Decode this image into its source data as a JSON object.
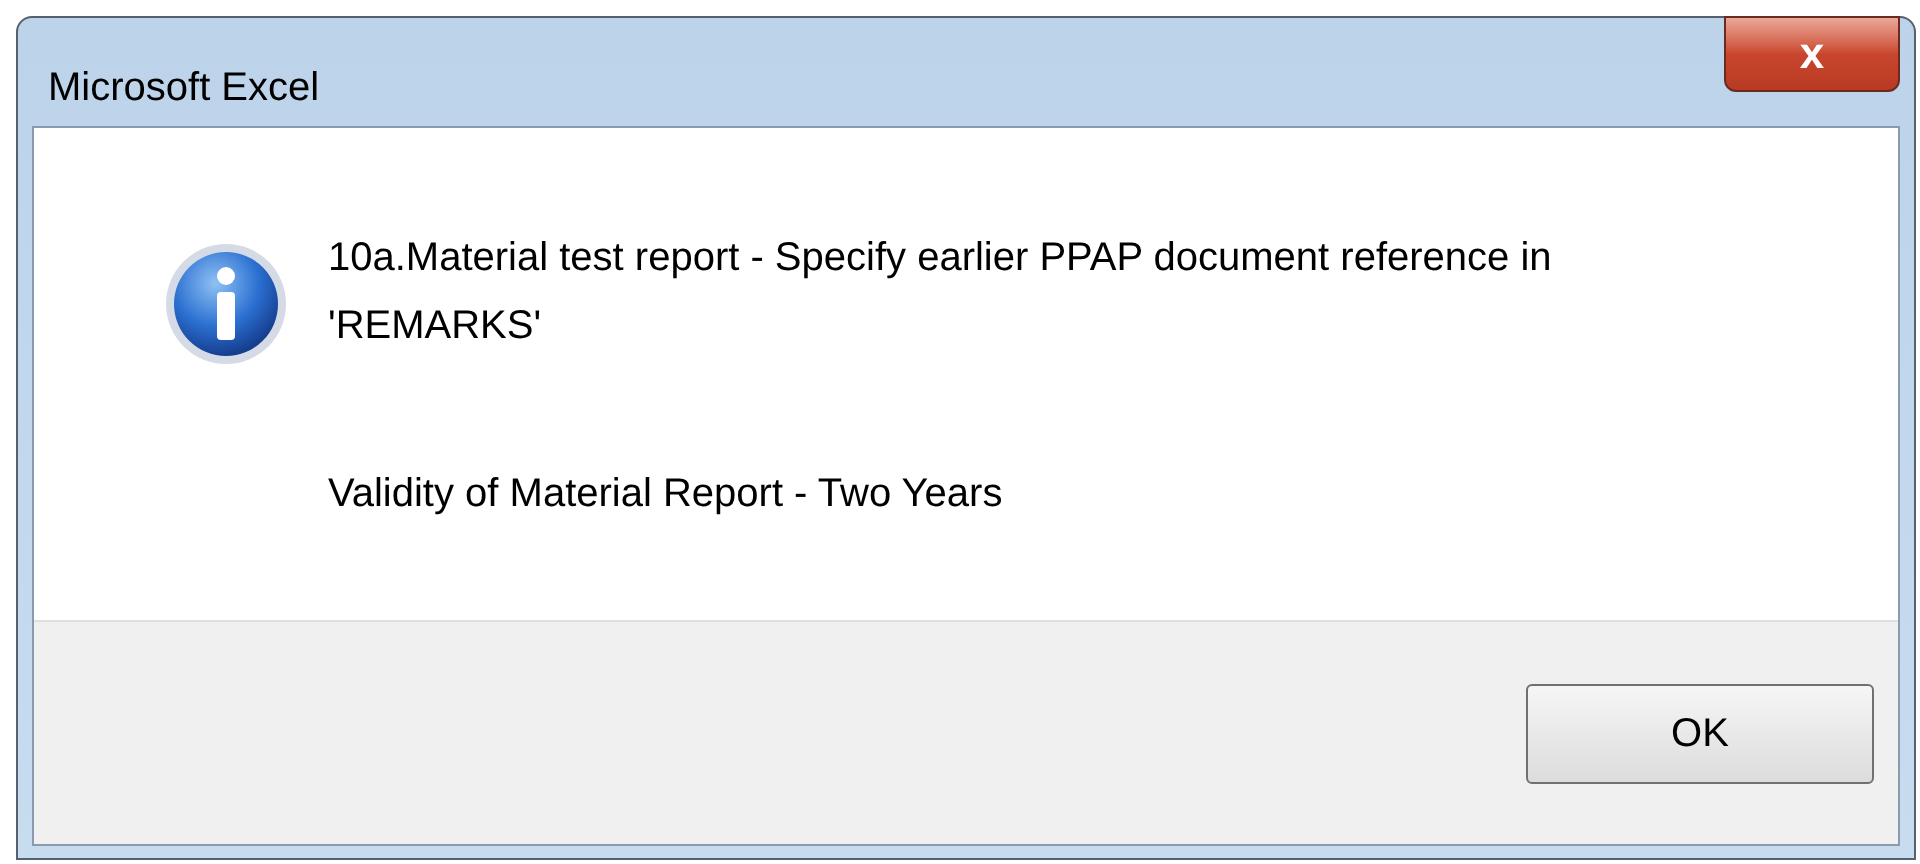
{
  "window": {
    "title": "Microsoft Excel",
    "close_label": "x"
  },
  "message": {
    "lines": [
      "10a.Material test report - Specify earlier PPAP document reference in 'REMARKS'",
      "Validity of Material Report - Two Years"
    ]
  },
  "buttons": [
    "OK"
  ]
}
